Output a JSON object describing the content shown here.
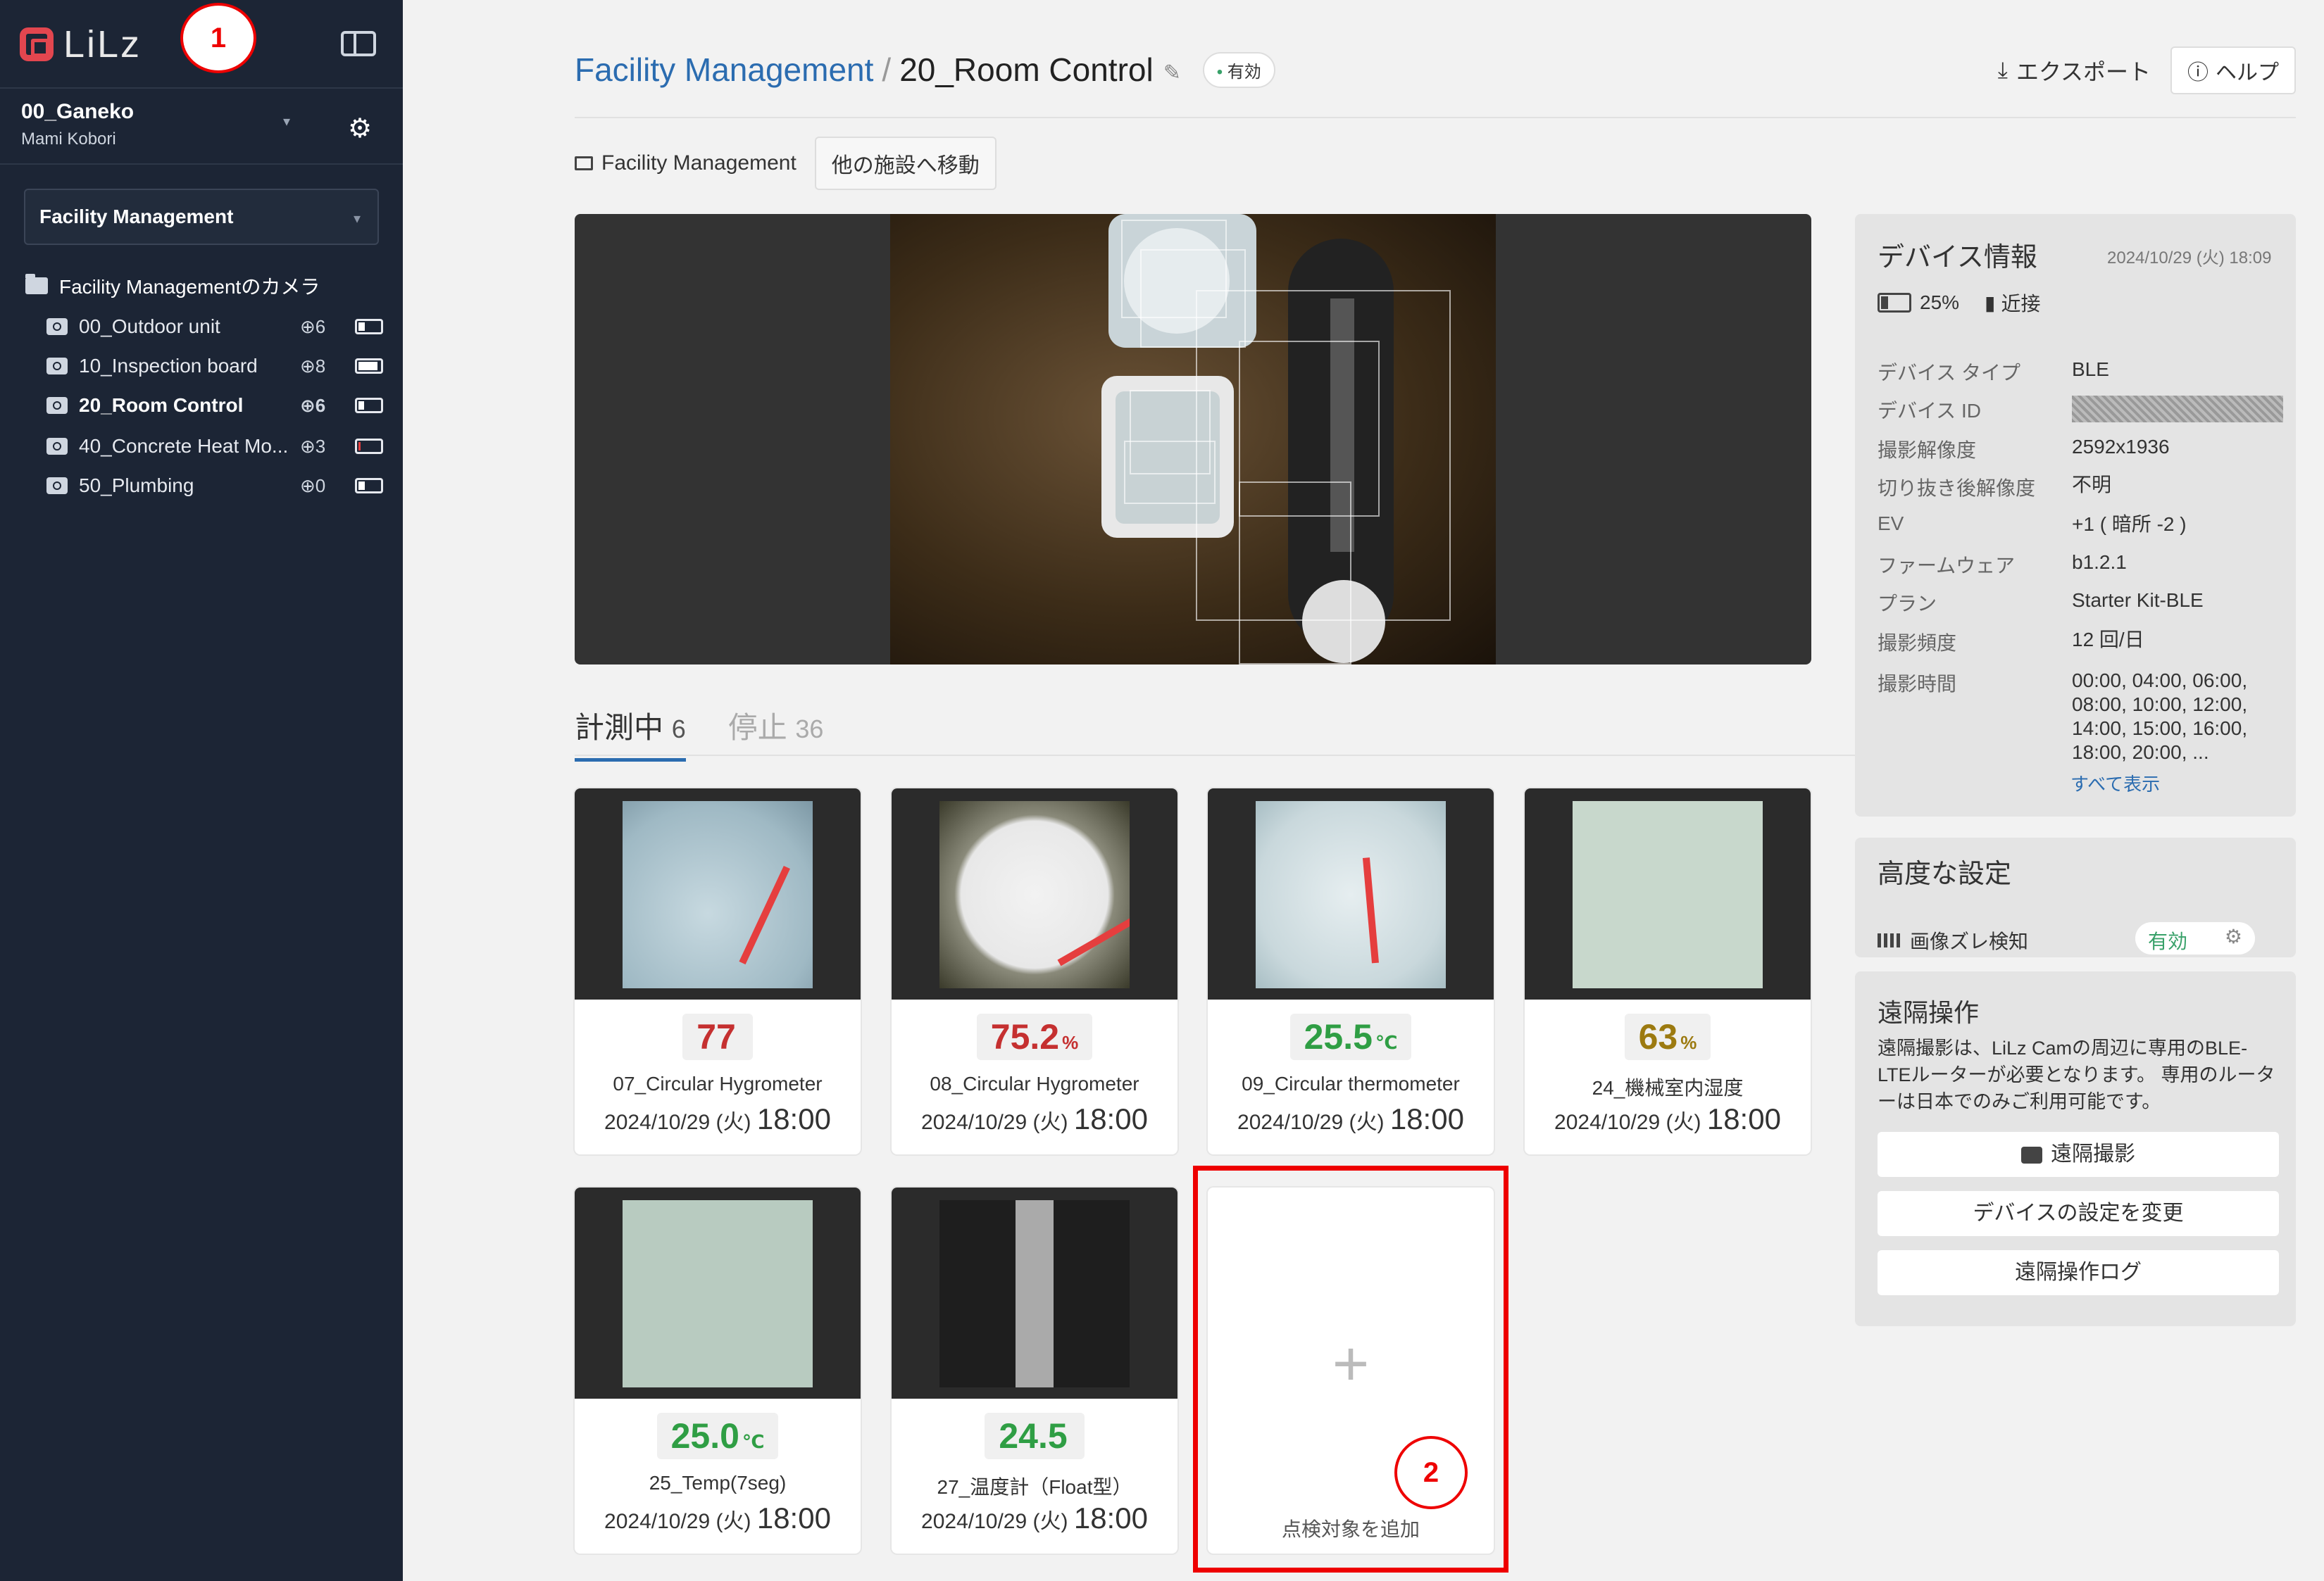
{
  "sidebar": {
    "logo_text": "LiLz",
    "badge1": "1",
    "workspace": {
      "name": "00_Ganeko",
      "user": "Mami Kobori"
    },
    "facility_select": "Facility Management",
    "tree_root": "Facility Managementのカメラ",
    "cameras": [
      {
        "name": "00_Outdoor unit",
        "count": "6",
        "battery": 0.3
      },
      {
        "name": "10_Inspection board",
        "count": "8",
        "battery": 0.9
      },
      {
        "name": "20_Room Control",
        "count": "6",
        "battery": 0.25
      },
      {
        "name": "40_Concrete Heat Mo...",
        "count": "3",
        "battery": 0.1
      },
      {
        "name": "50_Plumbing",
        "count": "0",
        "battery": 0.3
      }
    ]
  },
  "header": {
    "breadcrumb_root": "Facility Management",
    "breadcrumb_sep": "/",
    "title": "20_Room Control",
    "status": "有効",
    "export": "エクスポート",
    "help": "ヘルプ"
  },
  "facility": {
    "label": "Facility Management",
    "move": "他の施設へ移動"
  },
  "tabs": {
    "active": "計測中",
    "active_count": "6",
    "inactive": "停止",
    "inactive_count": "36"
  },
  "cards": [
    {
      "value": "77",
      "unit": "",
      "name": "07_Circular Hygrometer",
      "date": "2024/10/29 (火)",
      "time": "18:00",
      "color": "#c53030"
    },
    {
      "value": "75.2",
      "unit": "%",
      "name": "08_Circular Hygrometer",
      "date": "2024/10/29 (火)",
      "time": "18:00",
      "color": "#c53030"
    },
    {
      "value": "25.5",
      "unit": "℃",
      "name": "09_Circular thermometer",
      "date": "2024/10/29 (火)",
      "time": "18:00",
      "color": "#2f9e44"
    },
    {
      "value": "63",
      "unit": "%",
      "name": "24_機械室内湿度",
      "date": "2024/10/29 (火)",
      "time": "18:00",
      "color": "#9c7a10"
    },
    {
      "value": "25.0",
      "unit": "℃",
      "name": "25_Temp(7seg)",
      "date": "2024/10/29 (火)",
      "time": "18:00",
      "color": "#2f9e44"
    },
    {
      "value": "24.5",
      "unit": "",
      "name": "27_温度計（Float型）",
      "date": "2024/10/29 (火)",
      "time": "18:00",
      "color": "#2f9e44"
    }
  ],
  "add_card": {
    "plus": "+",
    "label": "点検対象を追加",
    "badge2": "2"
  },
  "device_info": {
    "title": "デバイス情報",
    "timestamp": "2024/10/29 (火) 18:09",
    "battery": "25%",
    "signal": "近接",
    "rows": [
      {
        "k": "デバイス タイプ",
        "v": "BLE"
      },
      {
        "k": "デバイス ID",
        "v": ""
      },
      {
        "k": "撮影解像度",
        "v": "2592x1936"
      },
      {
        "k": "切り抜き後解像度",
        "v": "不明"
      },
      {
        "k": "EV",
        "v": "+1 ( 暗所 -2 )"
      },
      {
        "k": "ファームウェア",
        "v": "b1.2.1"
      },
      {
        "k": "プラン",
        "v": "Starter Kit-BLE"
      },
      {
        "k": "撮影頻度",
        "v": "12 回/日"
      },
      {
        "k": "撮影時間",
        "v": "00:00, 04:00, 06:00, 08:00, 10:00, 12:00, 14:00, 15:00, 16:00, 18:00, 20:00, ..."
      }
    ],
    "show_all": "すべて表示"
  },
  "advanced": {
    "title": "高度な設定",
    "item": "画像ズレ検知",
    "status": "有効"
  },
  "remote": {
    "title": "遠隔操作",
    "desc": "遠隔撮影は、LiLz Camの周辺に専用のBLE-LTEルーターが必要となります。 専用のルーターは日本でのみご利用可能です。",
    "buttons": [
      "遠隔撮影",
      "デバイスの設定を変更",
      "遠隔操作ログ"
    ]
  }
}
